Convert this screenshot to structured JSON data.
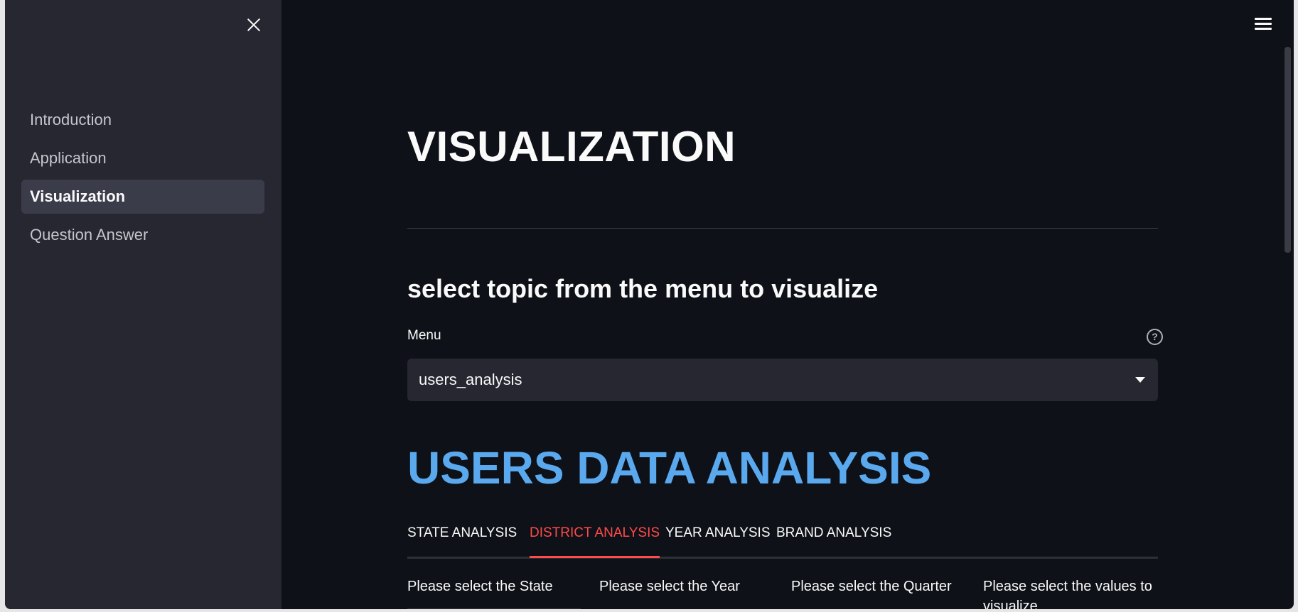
{
  "sidebar": {
    "items": [
      {
        "label": "Introduction"
      },
      {
        "label": "Application"
      },
      {
        "label": "Visualization"
      },
      {
        "label": "Question Answer"
      }
    ],
    "active_index": 2
  },
  "main": {
    "title": "VISUALIZATION",
    "subtitle": "select topic from the menu to visualize",
    "menu": {
      "label": "Menu",
      "selected": "users_analysis"
    },
    "section_title": "USERS DATA ANALYSIS",
    "tabs": [
      {
        "label": "STATE ANALYSIS"
      },
      {
        "label": "DISTRICT ANALYSIS"
      },
      {
        "label": "YEAR ANALYSIS"
      },
      {
        "label": "BRAND ANALYSIS"
      }
    ],
    "active_tab_index": 1,
    "filters": [
      {
        "label": "Please select the State"
      },
      {
        "label": "Please select the Year"
      },
      {
        "label": "Please select the Quarter"
      },
      {
        "label": "Please select the values to visualize"
      }
    ]
  },
  "colors": {
    "background": "#0e1117",
    "sidebar": "#262730",
    "accent": "#ff4b4b",
    "section_title": "#5aa9ee"
  }
}
